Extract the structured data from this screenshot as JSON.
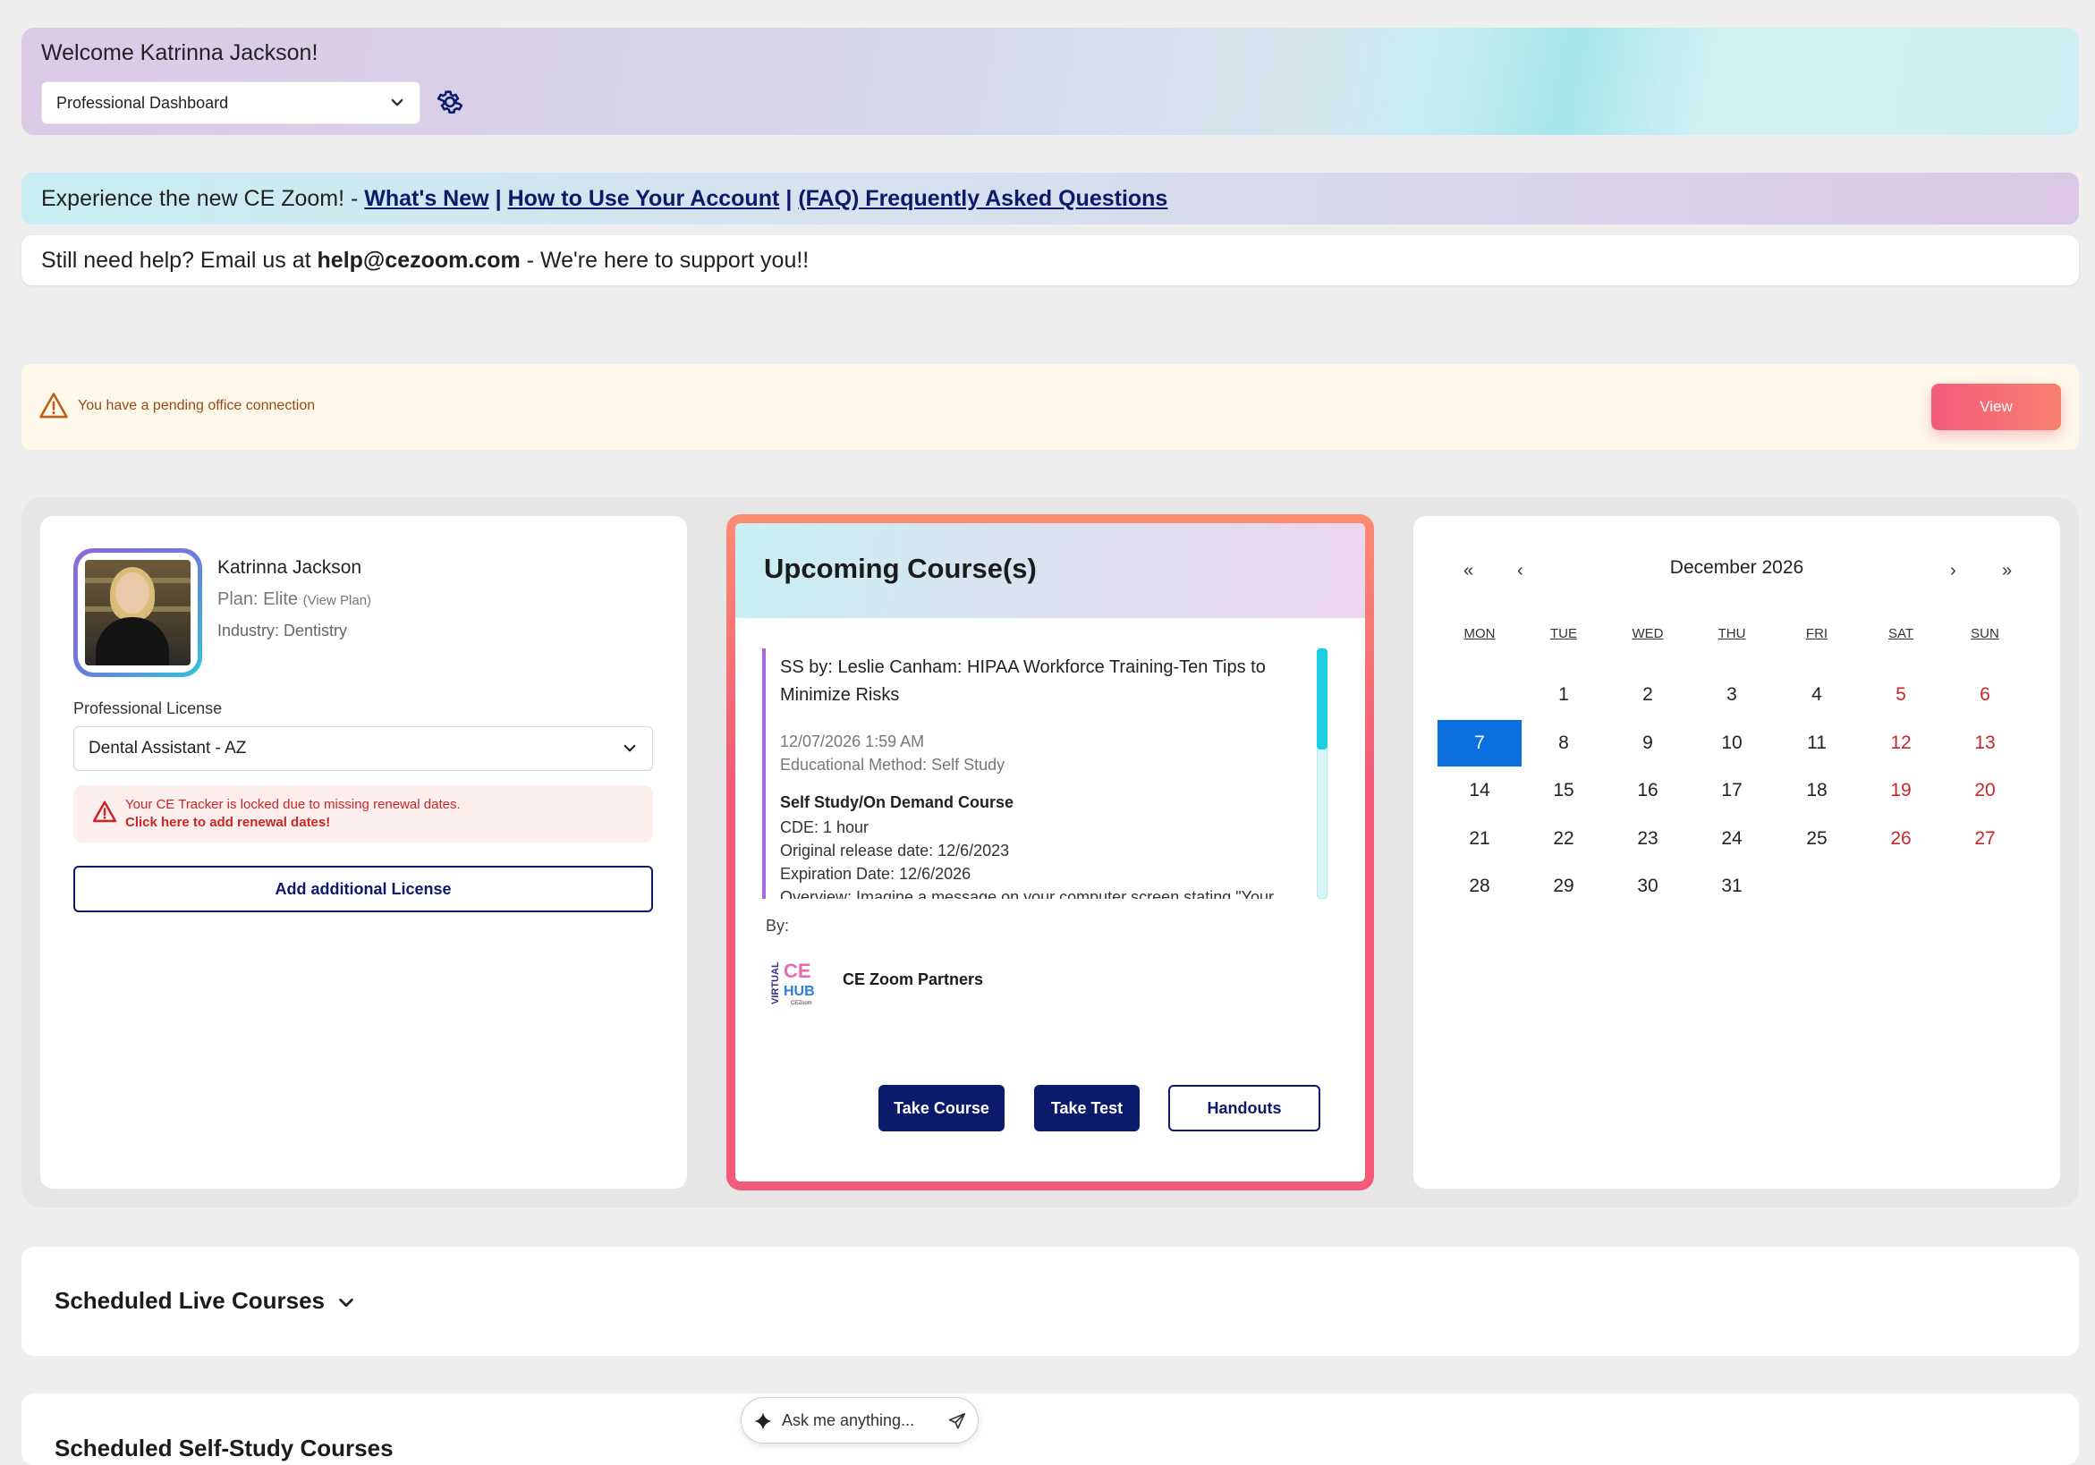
{
  "header": {
    "welcome": "Welcome Katrinna Jackson!",
    "dashboard_select": "Professional Dashboard"
  },
  "announcement": {
    "intro": "Experience the new CE Zoom! -",
    "links": [
      "What's New",
      "How to Use Your Account",
      "(FAQ) Frequently Asked Questions"
    ],
    "separator": "|"
  },
  "help": {
    "prefix": "Still need help? Email us at",
    "email": "help@cezoom.com",
    "suffix": "- We're here to support you!!"
  },
  "pending": {
    "message": "You have a pending office connection",
    "button": "View"
  },
  "profile": {
    "name": "Katrinna Jackson",
    "plan_label": "Plan: Elite",
    "view_plan": "(View Plan)",
    "industry": "Industry: Dentistry",
    "license_label": "Professional License",
    "license_value": "Dental Assistant - AZ",
    "locked_message": "Your CE Tracker is locked due to missing renewal dates.",
    "locked_link": "Click here to add renewal dates!",
    "add_license": "Add additional License"
  },
  "course": {
    "header": "Upcoming Course(s)",
    "title": "SS by: Leslie Canham: HIPAA Workforce Training-Ten Tips to Minimize Risks",
    "date": "12/07/2026 1:59 AM",
    "method": "Educational Method: Self Study",
    "type": "Self Study/On Demand Course",
    "cde": "CDE: 1 hour",
    "release": "Original release date: 12/6/2023",
    "expiration": "Expiration Date: 12/6/2026",
    "overview": "Overview: Imagine a message on your computer screen stating \"Your",
    "by_label": "By:",
    "partner": "CE Zoom Partners",
    "buttons": {
      "take_course": "Take Course",
      "take_test": "Take Test",
      "handouts": "Handouts"
    }
  },
  "calendar": {
    "month": "December 2026",
    "nav": {
      "first": "«",
      "prev": "‹",
      "next": "›",
      "last": "»"
    },
    "days_of_week": [
      "MON",
      "TUE",
      "WED",
      "THU",
      "FRI",
      "SAT",
      "SUN"
    ],
    "weeks": [
      [
        "",
        "1",
        "2",
        "3",
        "4",
        "5",
        "6"
      ],
      [
        "7",
        "8",
        "9",
        "10",
        "11",
        "12",
        "13"
      ],
      [
        "14",
        "15",
        "16",
        "17",
        "18",
        "19",
        "20"
      ],
      [
        "21",
        "22",
        "23",
        "24",
        "25",
        "26",
        "27"
      ],
      [
        "28",
        "29",
        "30",
        "31",
        "",
        "",
        ""
      ]
    ],
    "selected_day": "7"
  },
  "sections": {
    "live": "Scheduled Live Courses",
    "self_study": "Scheduled Self-Study Courses"
  },
  "assistant": {
    "placeholder": "Ask me anything..."
  },
  "colors": {
    "brand_navy": "#0b1a6b",
    "accent_pink": "#f25a78",
    "calendar_today": "#0b6fe0",
    "weekend_red": "#c62828"
  }
}
